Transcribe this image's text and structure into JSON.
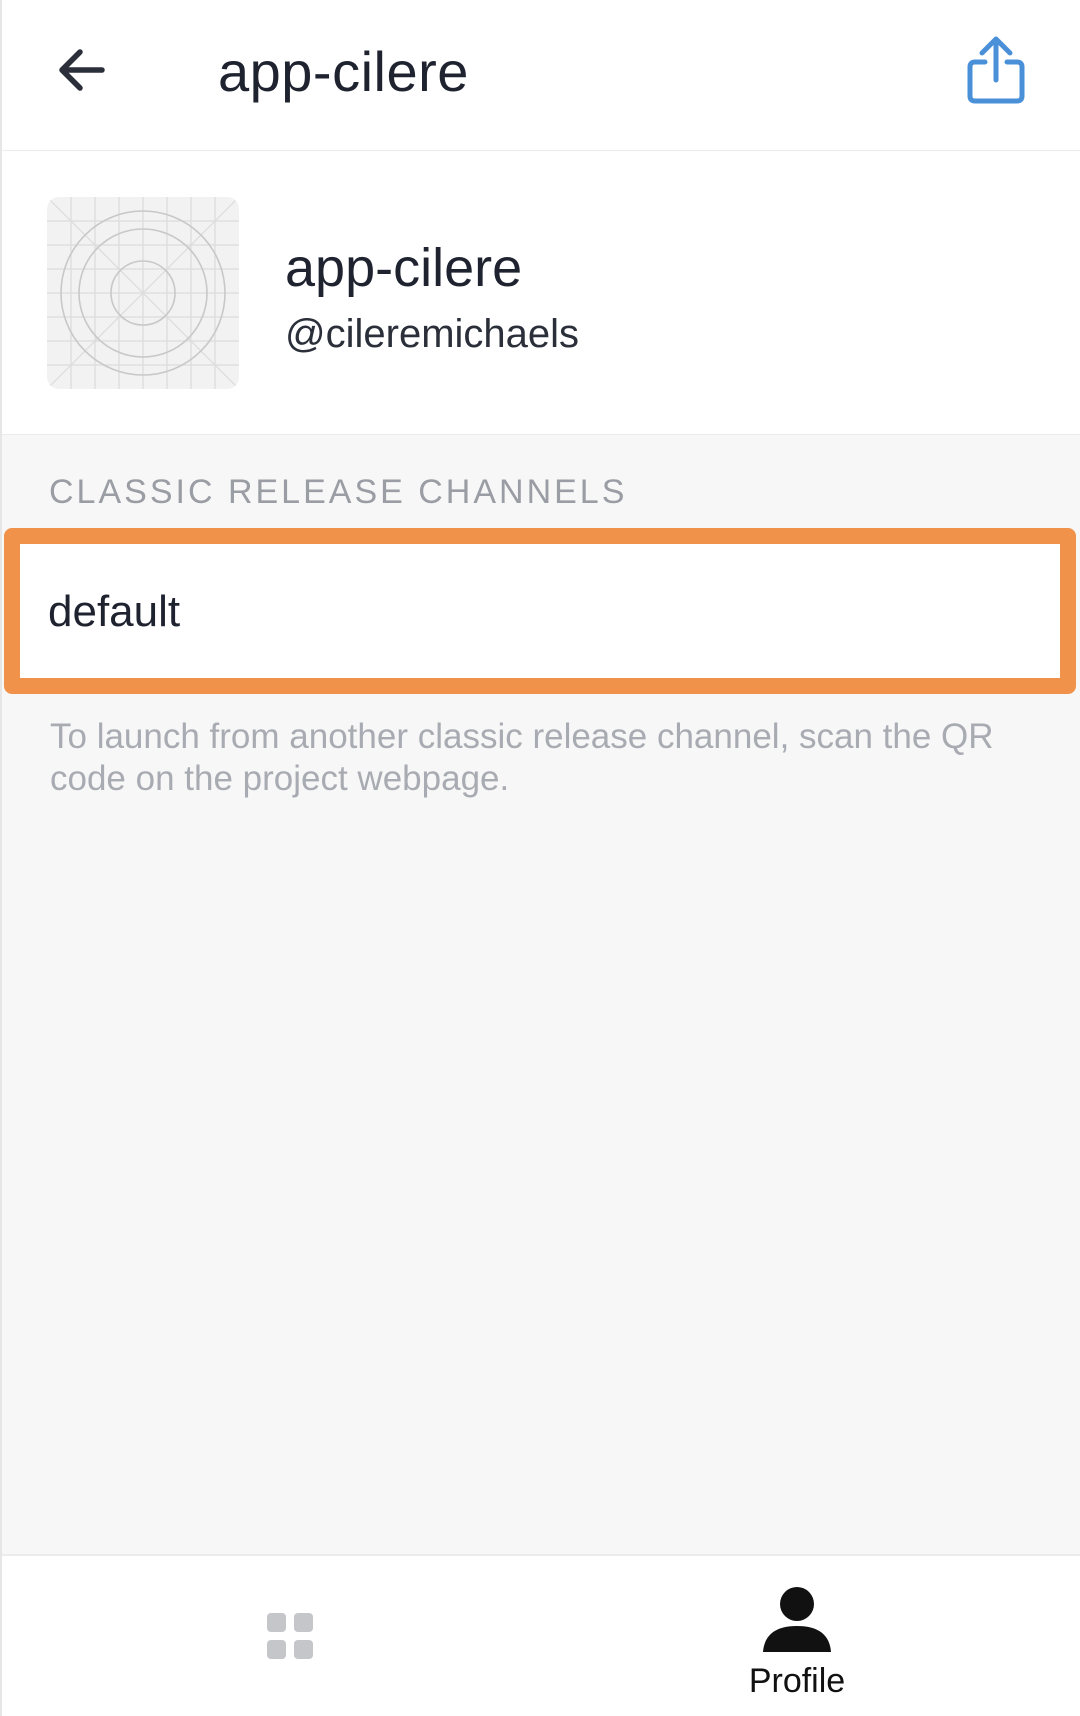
{
  "appbar": {
    "title": "app-cilere",
    "back_icon": "arrow-left-icon",
    "share_icon": "share-icon"
  },
  "project": {
    "name": "app-cilere",
    "owner": "@cileremichaels",
    "icon": "project-placeholder-icon"
  },
  "release_channels": {
    "section_title": "CLASSIC RELEASE CHANNELS",
    "items": [
      {
        "label": "default"
      }
    ],
    "hint": "To launch from another classic release channel, scan the QR code on the project webpage."
  },
  "bottom_nav": {
    "projects_icon": "grid-icon",
    "profile_icon": "person-icon",
    "profile_label": "Profile"
  },
  "colors": {
    "accent_blue": "#4a90d9",
    "highlight_orange": "#f0924a",
    "text_dark": "#1f2330",
    "muted": "#9a9da4"
  }
}
